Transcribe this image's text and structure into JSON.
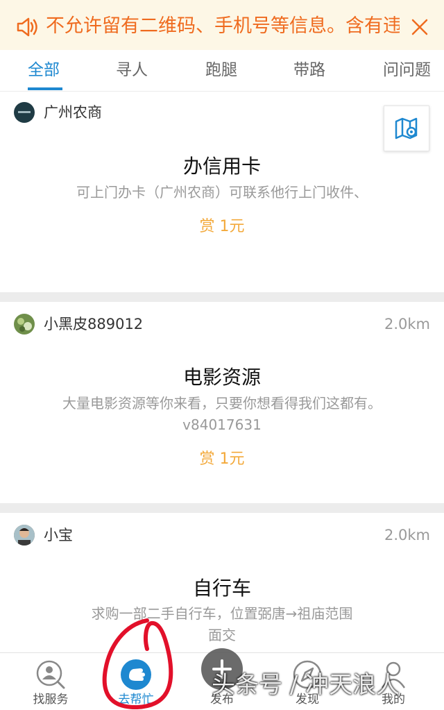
{
  "notice": {
    "text": "不允许留有二维码、手机号等信息。含有违规信息"
  },
  "tabs": [
    {
      "label": "全部",
      "active": true
    },
    {
      "label": "寻人"
    },
    {
      "label": "跑腿"
    },
    {
      "label": "带路"
    },
    {
      "label": "问问题"
    }
  ],
  "cards": [
    {
      "user": "广州农商",
      "distance": "",
      "title": "办信用卡",
      "desc": "可上门办卡（广州农商）可联系他行上门收件、",
      "reward": "赏 1元"
    },
    {
      "user": "小黑皮889012",
      "distance": "2.0km",
      "title": "电影资源",
      "desc": "大量电影资源等你来看，只要你想看得我们这都有。v84017631",
      "reward": "赏 1元"
    },
    {
      "user": "小宝",
      "distance": "2.0km",
      "title": "自行车",
      "desc": "求购一部二手自行车，位置弼唐→祖庙范围面交",
      "reward": ""
    }
  ],
  "bottom_nav": [
    {
      "label": "找服务"
    },
    {
      "label": "去帮忙",
      "active": true
    },
    {
      "label": "发布"
    },
    {
      "label": "发现"
    },
    {
      "label": "我的"
    }
  ],
  "watermark": "头条号 / 冲天浪人",
  "colors": {
    "accent": "#1e88d0",
    "notice_text": "#ef6b1f",
    "reward": "#f3a93a",
    "annotation": "#e2102a"
  }
}
